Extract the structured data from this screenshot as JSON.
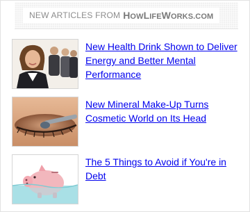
{
  "header": {
    "prefix": "NEW ARTICLES FROM",
    "brand_initials": [
      "H",
      "L",
      "W"
    ],
    "brand_parts": [
      "H",
      "OW",
      "L",
      "IFE",
      "W",
      "ORKS",
      ".COM"
    ]
  },
  "articles": [
    {
      "title": "New Health Drink Shown to Deliver Energy and Better Mental Performance",
      "image": "business-woman-photo"
    },
    {
      "title": "New Mineral Make-Up Turns Cosmetic World on Its Head",
      "image": "eye-makeup-photo"
    },
    {
      "title": "The 5 Things to Avoid if You're in Debt",
      "image": "piggy-bank-water-photo"
    }
  ],
  "colors": {
    "link": "#0000ee",
    "header_text": "#8c8c8c",
    "border": "#e2e2e2"
  }
}
